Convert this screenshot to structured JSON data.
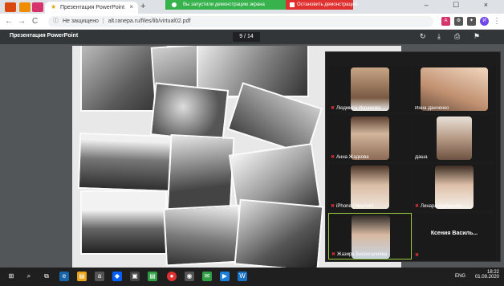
{
  "browser": {
    "tab_title": "Презентация PowerPoint",
    "tab_close": "×",
    "new_tab": "+",
    "window_controls": "– ☐ ×",
    "url_warning": "Не защищено",
    "url_sep": "|",
    "url": "alt.ranepa.ru/files/lib/virtual02.pdf",
    "back": "←",
    "forward": "→",
    "reload": "C"
  },
  "demo_banner": {
    "status": "Вы запустили демонстрацию экрана",
    "stop_label": "Остановить демонстрацию",
    "green_color": "#37b24d",
    "red_color": "#e03131"
  },
  "pdf": {
    "title": "Презентация PowerPoint",
    "page": "9 / 14",
    "rotate_icon": "↻",
    "download_icon": "⤓",
    "print_icon": "⎙",
    "bookmark_icon": "⚑",
    "more_icon": "⋮"
  },
  "participants": [
    {
      "name": "Людмила Икрамова",
      "muted": true
    },
    {
      "name": "Инна Данченко",
      "muted": false
    },
    {
      "name": "Анна Жадкова",
      "muted": true
    },
    {
      "name": "Даша",
      "muted": false
    },
    {
      "name": "iPhone (Эмилия)",
      "muted": true
    },
    {
      "name": "Линара Курбанова",
      "muted": true
    },
    {
      "name": "Жазира Бисенгалиева",
      "muted": true
    },
    {
      "name": "Ксения Василь...",
      "muted": true
    }
  ],
  "taskbar": {
    "lang": "ENG",
    "time": "18:22",
    "date": "01.09.2020"
  }
}
